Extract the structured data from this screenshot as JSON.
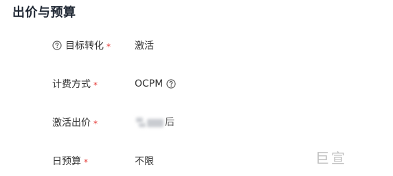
{
  "section": {
    "title": "出价与预算"
  },
  "rows": [
    {
      "label": "目标转化",
      "required_mark": "*",
      "value": "激活",
      "label_icon": "question-circle-icon"
    },
    {
      "label": "计费方式",
      "required_mark": "*",
      "value": "OCPM",
      "value_icon": "question-circle-icon"
    },
    {
      "label": "激活出价",
      "required_mark": "*",
      "value_tail": "后"
    },
    {
      "label": "日预算",
      "required_mark": "*",
      "value": "不限"
    }
  ],
  "watermark": "巨宣",
  "colors": {
    "required": "#e53935",
    "title": "#1f2733",
    "text": "#333333",
    "watermark": "#bfbfbf"
  }
}
